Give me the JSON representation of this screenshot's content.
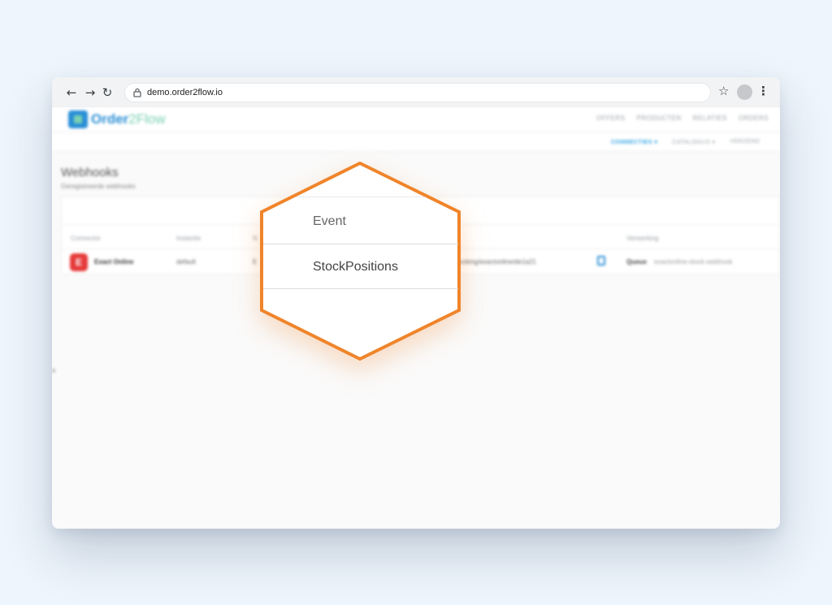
{
  "browser": {
    "url": "demo.order2flow.io",
    "back_icon": "arrow-left-icon",
    "forward_icon": "arrow-right-icon",
    "reload_icon": "reload-icon",
    "lock_icon": "lock-icon",
    "bookmark_icon": "star-icon",
    "menu_icon": "kebab-icon"
  },
  "app": {
    "logo": {
      "primary": "Order",
      "secondary": "2Flow"
    },
    "top_nav": [
      "OFFERS",
      "PRODUCTEN",
      "RELATIES",
      "ORDERS"
    ],
    "sub_nav": [
      {
        "label": "CONNECTIES ▾",
        "active": true
      },
      {
        "label": "CATALOGUS ▾",
        "active": false
      },
      {
        "label": "VERZEND",
        "active": false
      }
    ],
    "page_title": "Webhooks",
    "page_subtitle": "Geregistreerde webhooks",
    "table": {
      "headers": [
        "Connector",
        "Instantie",
        "N",
        "Verwerking"
      ],
      "row": {
        "connector": "Exact Online",
        "instance": "default",
        "name_fragment": "E",
        "url": "k/booking/exactonline/de1a21",
        "processing": "Queue",
        "processing_detail": "exactonline-stock-webhook"
      }
    }
  },
  "callout": {
    "header": "Event",
    "value": "StockPositions",
    "stroke_color": "#f0842a"
  },
  "colors": {
    "accent": "#2a8fd6",
    "brand_green": "#7ad0b3",
    "exact_red": "#e63a3a",
    "highlight": "#f0842a"
  }
}
